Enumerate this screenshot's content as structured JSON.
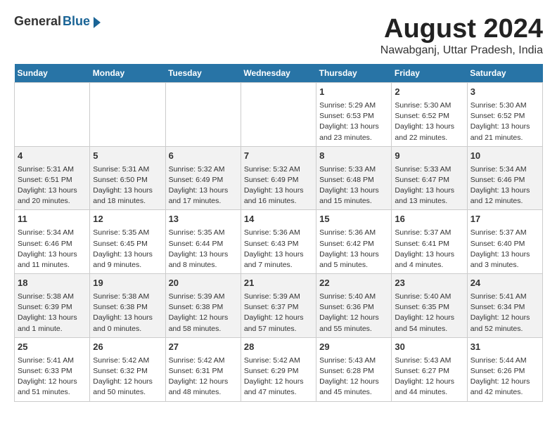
{
  "logo": {
    "general": "General",
    "blue": "Blue"
  },
  "title": "August 2024",
  "subtitle": "Nawabganj, Uttar Pradesh, India",
  "days_of_week": [
    "Sunday",
    "Monday",
    "Tuesday",
    "Wednesday",
    "Thursday",
    "Friday",
    "Saturday"
  ],
  "weeks": [
    [
      {
        "num": "",
        "info": ""
      },
      {
        "num": "",
        "info": ""
      },
      {
        "num": "",
        "info": ""
      },
      {
        "num": "",
        "info": ""
      },
      {
        "num": "1",
        "info": "Sunrise: 5:29 AM\nSunset: 6:53 PM\nDaylight: 13 hours and 23 minutes."
      },
      {
        "num": "2",
        "info": "Sunrise: 5:30 AM\nSunset: 6:52 PM\nDaylight: 13 hours and 22 minutes."
      },
      {
        "num": "3",
        "info": "Sunrise: 5:30 AM\nSunset: 6:52 PM\nDaylight: 13 hours and 21 minutes."
      }
    ],
    [
      {
        "num": "4",
        "info": "Sunrise: 5:31 AM\nSunset: 6:51 PM\nDaylight: 13 hours and 20 minutes."
      },
      {
        "num": "5",
        "info": "Sunrise: 5:31 AM\nSunset: 6:50 PM\nDaylight: 13 hours and 18 minutes."
      },
      {
        "num": "6",
        "info": "Sunrise: 5:32 AM\nSunset: 6:49 PM\nDaylight: 13 hours and 17 minutes."
      },
      {
        "num": "7",
        "info": "Sunrise: 5:32 AM\nSunset: 6:49 PM\nDaylight: 13 hours and 16 minutes."
      },
      {
        "num": "8",
        "info": "Sunrise: 5:33 AM\nSunset: 6:48 PM\nDaylight: 13 hours and 15 minutes."
      },
      {
        "num": "9",
        "info": "Sunrise: 5:33 AM\nSunset: 6:47 PM\nDaylight: 13 hours and 13 minutes."
      },
      {
        "num": "10",
        "info": "Sunrise: 5:34 AM\nSunset: 6:46 PM\nDaylight: 13 hours and 12 minutes."
      }
    ],
    [
      {
        "num": "11",
        "info": "Sunrise: 5:34 AM\nSunset: 6:46 PM\nDaylight: 13 hours and 11 minutes."
      },
      {
        "num": "12",
        "info": "Sunrise: 5:35 AM\nSunset: 6:45 PM\nDaylight: 13 hours and 9 minutes."
      },
      {
        "num": "13",
        "info": "Sunrise: 5:35 AM\nSunset: 6:44 PM\nDaylight: 13 hours and 8 minutes."
      },
      {
        "num": "14",
        "info": "Sunrise: 5:36 AM\nSunset: 6:43 PM\nDaylight: 13 hours and 7 minutes."
      },
      {
        "num": "15",
        "info": "Sunrise: 5:36 AM\nSunset: 6:42 PM\nDaylight: 13 hours and 5 minutes."
      },
      {
        "num": "16",
        "info": "Sunrise: 5:37 AM\nSunset: 6:41 PM\nDaylight: 13 hours and 4 minutes."
      },
      {
        "num": "17",
        "info": "Sunrise: 5:37 AM\nSunset: 6:40 PM\nDaylight: 13 hours and 3 minutes."
      }
    ],
    [
      {
        "num": "18",
        "info": "Sunrise: 5:38 AM\nSunset: 6:39 PM\nDaylight: 13 hours and 1 minute."
      },
      {
        "num": "19",
        "info": "Sunrise: 5:38 AM\nSunset: 6:38 PM\nDaylight: 13 hours and 0 minutes."
      },
      {
        "num": "20",
        "info": "Sunrise: 5:39 AM\nSunset: 6:38 PM\nDaylight: 12 hours and 58 minutes."
      },
      {
        "num": "21",
        "info": "Sunrise: 5:39 AM\nSunset: 6:37 PM\nDaylight: 12 hours and 57 minutes."
      },
      {
        "num": "22",
        "info": "Sunrise: 5:40 AM\nSunset: 6:36 PM\nDaylight: 12 hours and 55 minutes."
      },
      {
        "num": "23",
        "info": "Sunrise: 5:40 AM\nSunset: 6:35 PM\nDaylight: 12 hours and 54 minutes."
      },
      {
        "num": "24",
        "info": "Sunrise: 5:41 AM\nSunset: 6:34 PM\nDaylight: 12 hours and 52 minutes."
      }
    ],
    [
      {
        "num": "25",
        "info": "Sunrise: 5:41 AM\nSunset: 6:33 PM\nDaylight: 12 hours and 51 minutes."
      },
      {
        "num": "26",
        "info": "Sunrise: 5:42 AM\nSunset: 6:32 PM\nDaylight: 12 hours and 50 minutes."
      },
      {
        "num": "27",
        "info": "Sunrise: 5:42 AM\nSunset: 6:31 PM\nDaylight: 12 hours and 48 minutes."
      },
      {
        "num": "28",
        "info": "Sunrise: 5:42 AM\nSunset: 6:29 PM\nDaylight: 12 hours and 47 minutes."
      },
      {
        "num": "29",
        "info": "Sunrise: 5:43 AM\nSunset: 6:28 PM\nDaylight: 12 hours and 45 minutes."
      },
      {
        "num": "30",
        "info": "Sunrise: 5:43 AM\nSunset: 6:27 PM\nDaylight: 12 hours and 44 minutes."
      },
      {
        "num": "31",
        "info": "Sunrise: 5:44 AM\nSunset: 6:26 PM\nDaylight: 12 hours and 42 minutes."
      }
    ]
  ]
}
